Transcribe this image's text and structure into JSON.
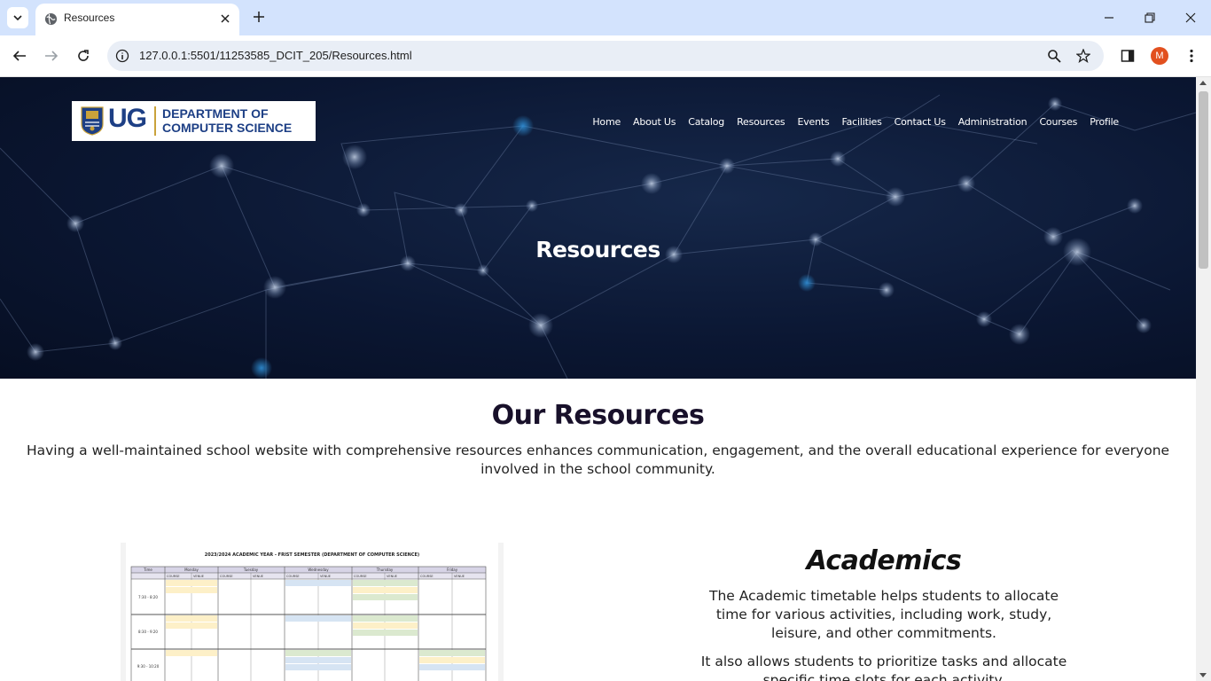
{
  "browser": {
    "tab_title": "Resources",
    "url": "127.0.0.1:5501/11253585_DCIT_205/Resources.html",
    "profile_initial": "M"
  },
  "site": {
    "logo": {
      "ug": "UG",
      "line1": "DEPARTMENT OF",
      "line2": "COMPUTER SCIENCE"
    },
    "nav": [
      "Home",
      "About Us",
      "Catalog",
      "Resources",
      "Events",
      "Facilities",
      "Contact Us",
      "Administration",
      "Courses",
      "Profile"
    ],
    "hero_title": "Resources"
  },
  "main": {
    "section_title": "Our Resources",
    "section_text": "Having a well-maintained school website with comprehensive resources enhances communication, engagement, and the overall educational experience for everyone involved in the school community.",
    "academics": {
      "title": "Academics",
      "p1": "The Academic timetable helps students to allocate time for various activities, including work, study, leisure, and other commitments.",
      "p2": "It also allows students to prioritize tasks and allocate specific time slots for each activity."
    },
    "timetable": {
      "heading": "2023/2024 ACADEMIC YEAR - FRIST SEMESTER (DEPARTMENT OF COMPUTER SCIENCE)",
      "days": [
        "Monday",
        "Tuesday",
        "Wednesday",
        "Thursday",
        "Friday"
      ],
      "first_col": "Time",
      "sub_cols": [
        "COURSE",
        "VENUE"
      ],
      "times": [
        "7:30 - 8:20",
        "8:30 - 9:20",
        "9:30 - 10:20"
      ]
    }
  }
}
